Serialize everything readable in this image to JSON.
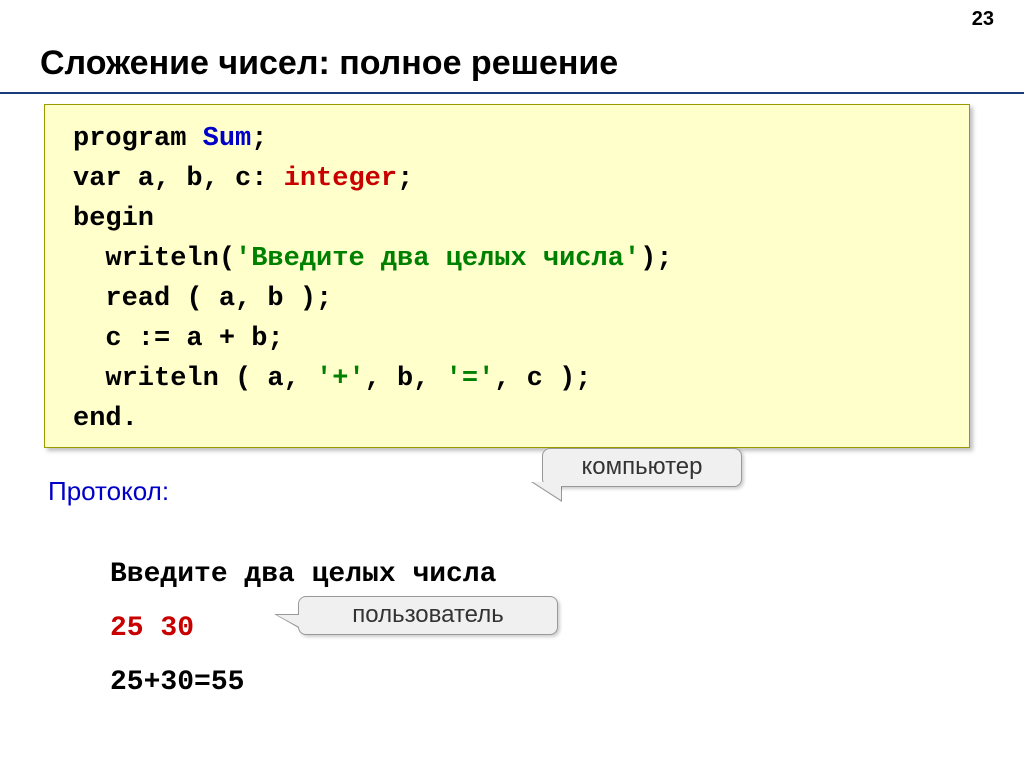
{
  "page_number": "23",
  "title": "Сложение чисел: полное решение",
  "code": {
    "l1_a": "program ",
    "l1_b": "Sum",
    "l1_c": ";",
    "l2_a": "var a, b, c: ",
    "l2_b": "integer",
    "l2_c": ";",
    "l3": "begin",
    "l4_a": "  writeln(",
    "l4_b": "'Введите два целых числа'",
    "l4_c": ");",
    "l5": "  read ( a, b );",
    "l6": "  c := a + b;",
    "l7_a": "  writeln ( a, ",
    "l7_b": "'+'",
    "l7_c": ", b, ",
    "l7_d": "'='",
    "l7_e": ", c );",
    "l8": "end."
  },
  "protocol_label": "Протокол:",
  "console": {
    "line1": "Введите два целых числа",
    "line2": "25 30",
    "line3": "25+30=55"
  },
  "callouts": {
    "computer": "компьютер",
    "user": "пользователь"
  }
}
